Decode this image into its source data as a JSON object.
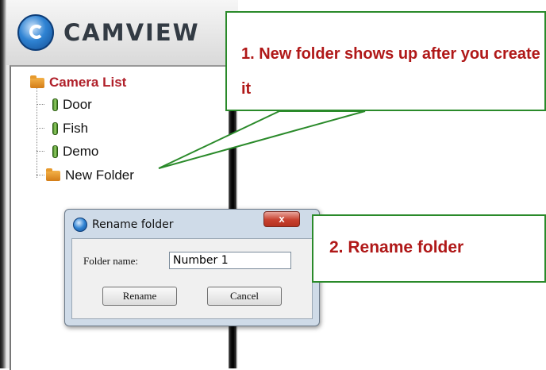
{
  "app": {
    "logo_text": "CAMVIEW",
    "tree": {
      "root_label": "Camera List",
      "items": [
        {
          "label": "Door",
          "icon": "camera-icon"
        },
        {
          "label": "Fish",
          "icon": "camera-icon"
        },
        {
          "label": "Demo",
          "icon": "camera-icon"
        },
        {
          "label": "New Folder",
          "icon": "folder-icon"
        }
      ]
    }
  },
  "dialog": {
    "title": "Rename folder",
    "close_label": "x",
    "field_label": "Folder name:",
    "field_value": "Number 1",
    "rename_button": "Rename",
    "cancel_button": "Cancel"
  },
  "callouts": {
    "first": "1. New folder shows up after you create it",
    "second": "2. Rename folder"
  },
  "colors": {
    "callout_text": "#b01818",
    "callout_border": "#2a8a2a",
    "root_label": "#b0202a"
  }
}
